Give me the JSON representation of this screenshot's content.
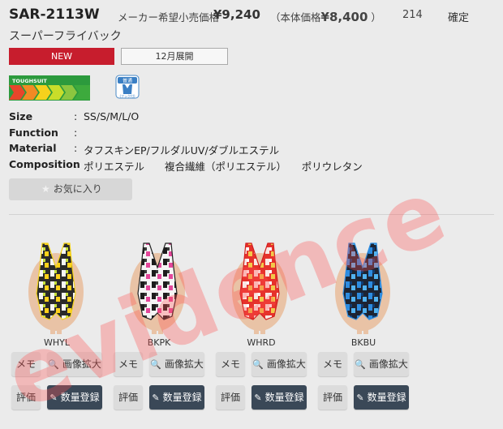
{
  "product": {
    "code": "SAR-2113W",
    "price_label": "メーカー希望小売価格",
    "price": "¥9,240",
    "body_price_prefix": "（本体価格",
    "body_price": "¥8,400",
    "body_price_suffix": "）",
    "count": "214",
    "status": "確定",
    "subtitle": "スーパーフライバック"
  },
  "badges": {
    "new": "NEW",
    "month": "12月展開"
  },
  "icons": {
    "logo": "toughsuit-logo",
    "logo_text": "TOUGHSUIT",
    "type_icon": "swimsuit-type-icon",
    "type_icon_top": "普通",
    "type_icon_bottom": "(フック付)",
    "star": "star-icon",
    "zoom": "zoom-icon",
    "edit": "edit-icon"
  },
  "specs": [
    {
      "key": "Size",
      "colon": ":",
      "value": "SS/S/M/L/O"
    },
    {
      "key": "Function",
      "colon": ":",
      "value": ""
    },
    {
      "key": "Material",
      "colon": ":",
      "value": "タフスキンEP/フルダルUV/ダブルエステル"
    },
    {
      "key": "Composition",
      "colon": ":",
      "value": "ポリエステル　　複合繊維（ポリエステル）　　ポリウレタン"
    }
  ],
  "favorite_label": "お気に入り",
  "variants": [
    {
      "color": "WHYL"
    },
    {
      "color": "BKPK"
    },
    {
      "color": "WHRD"
    },
    {
      "color": "BKBU"
    }
  ],
  "buttons": {
    "memo": "メモ",
    "zoom": "画像拡大",
    "review": "評価",
    "register": "数量登録"
  },
  "watermark": "evidence",
  "colors": {
    "accent_red": "#c71d2d",
    "dark_button": "#3a4857",
    "background": "#ebebeb"
  }
}
